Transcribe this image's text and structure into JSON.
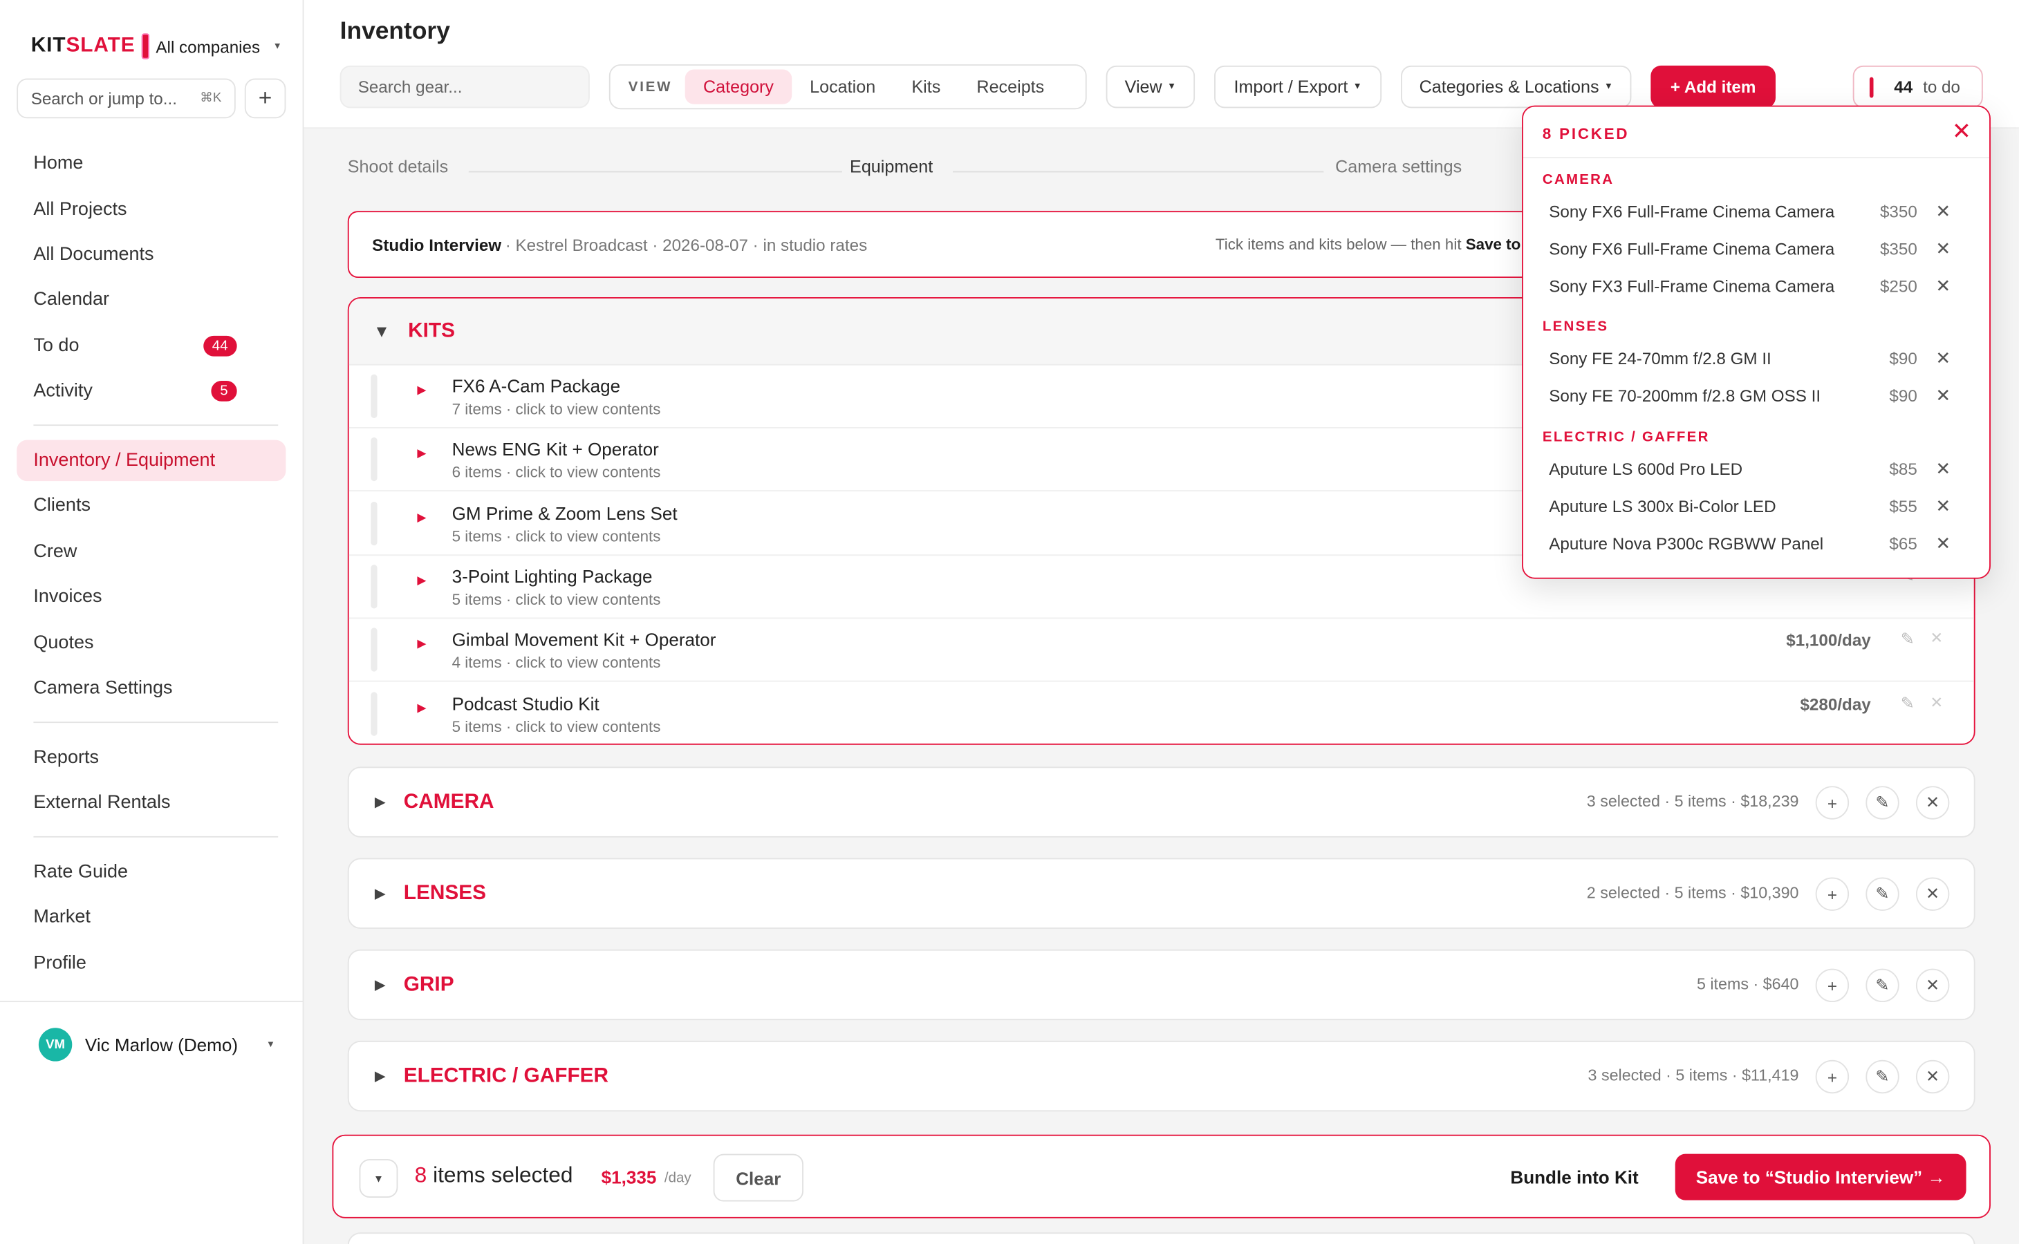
{
  "sidebar": {
    "logo_kit": "KIT",
    "logo_slate": "SLATE",
    "company": "All companies",
    "search_placeholder": "Search or jump to...",
    "search_shortcut": "⌘K",
    "add_icon": "+",
    "nav": [
      {
        "label": "Home"
      },
      {
        "label": "All Projects"
      },
      {
        "label": "All Documents"
      },
      {
        "label": "Calendar"
      },
      {
        "label": "To do",
        "badge": "44"
      },
      {
        "label": "Activity",
        "badge": "5"
      },
      {
        "label": "Inventory / Equipment",
        "active": true
      },
      {
        "label": "Clients"
      },
      {
        "label": "Crew"
      },
      {
        "label": "Invoices"
      },
      {
        "label": "Quotes"
      },
      {
        "label": "Camera Settings"
      },
      {
        "label": "Reports"
      },
      {
        "label": "External Rentals"
      },
      {
        "label": "Rate Guide"
      },
      {
        "label": "Market"
      },
      {
        "label": "Profile"
      }
    ],
    "user": {
      "initials": "VM",
      "name": "Vic Marlow (Demo)"
    }
  },
  "header": {
    "title": "Inventory",
    "search_placeholder": "Search gear...",
    "view_label": "VIEW",
    "tabs": [
      "Category",
      "Location",
      "Kits",
      "Receipts"
    ],
    "active_tab": "Category",
    "view_btn": "View",
    "import_export": "Import / Export",
    "categories_locations": "Categories & Locations",
    "add_item": "+ Add item",
    "todo_count": "44",
    "todo_label": "to do"
  },
  "steps": [
    "Shoot details",
    "Equipment",
    "Camera settings"
  ],
  "shoot": {
    "name": "Studio Interview",
    "details": "· Kestrel Broadcast · 2026-08-07 · in studio rates",
    "hint_prefix": "Tick items and kits below — then hit",
    "hint_bold": "Save to"
  },
  "kits": {
    "title": "KITS",
    "rows": [
      {
        "name": "FX6 A-Cam Package",
        "sub": "7 items · click to view contents",
        "price": ""
      },
      {
        "name": "News ENG Kit + Operator",
        "sub": "6 items · click to view contents",
        "price": ""
      },
      {
        "name": "GM Prime & Zoom Lens Set",
        "sub": "5 items · click to view contents",
        "price": ""
      },
      {
        "name": "3-Point Lighting Package",
        "sub": "5 items · click to view contents",
        "price": ""
      },
      {
        "name": "Gimbal Movement Kit + Operator",
        "sub": "4 items · click to view contents",
        "price": "$1,100/day"
      },
      {
        "name": "Podcast Studio Kit",
        "sub": "5 items · click to view contents",
        "price": "$280/day"
      }
    ]
  },
  "categories": [
    {
      "title": "CAMERA",
      "meta": "3 selected · 5 items · $18,239"
    },
    {
      "title": "LENSES",
      "meta": "2 selected · 5 items · $10,390"
    },
    {
      "title": "GRIP",
      "meta": "5 items · $640"
    },
    {
      "title": "ELECTRIC / GAFFER",
      "meta": "3 selected · 5 items · $11,419"
    }
  ],
  "bottom": {
    "count": "8",
    "count_label": "items selected",
    "total": "$1,335",
    "unit": "/day",
    "clear": "Clear",
    "bundle": "Bundle into Kit",
    "save": "Save to “Studio Interview” →"
  },
  "picked": {
    "title": "8 PICKED",
    "groups": [
      {
        "name": "CAMERA",
        "items": [
          {
            "name": "Sony FX6 Full-Frame Cinema Camera",
            "price": "$350"
          },
          {
            "name": "Sony FX6 Full-Frame Cinema Camera",
            "price": "$350"
          },
          {
            "name": "Sony FX3 Full-Frame Cinema Camera",
            "price": "$250"
          }
        ]
      },
      {
        "name": "LENSES",
        "items": [
          {
            "name": "Sony FE 24-70mm f/2.8 GM II",
            "price": "$90"
          },
          {
            "name": "Sony FE 70-200mm f/2.8 GM OSS II",
            "price": "$90"
          }
        ]
      },
      {
        "name": "ELECTRIC / GAFFER",
        "items": [
          {
            "name": "Aputure LS 600d Pro LED",
            "price": "$85"
          },
          {
            "name": "Aputure LS 300x Bi-Color LED",
            "price": "$55"
          },
          {
            "name": "Aputure Nova P300c RGBWW Panel",
            "price": "$65"
          }
        ]
      }
    ]
  },
  "colors": {
    "accent": "#e0103a",
    "accent_soft": "#fde4ea",
    "avatar": "#19b7a6"
  }
}
